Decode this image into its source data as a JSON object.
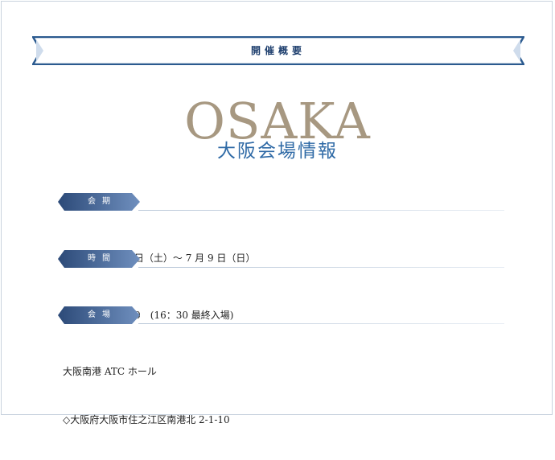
{
  "banner": {
    "title": "開催概要"
  },
  "hero": {
    "city": "OSAKA",
    "subtitle": "大阪会場情報"
  },
  "sections": [
    {
      "label": "会期",
      "lines": [
        "2017 年 7 月 8 日（土）～ 7 月 9 日（日）"
      ]
    },
    {
      "label": "時間",
      "lines": [
        "10：00 - 17：00　(16：30 最終入場)"
      ]
    },
    {
      "label": "会場",
      "lines": [
        "大阪南港 ATC ホール",
        "◇大阪府大阪市住之江区南港北 2-1-10"
      ]
    }
  ],
  "colors": {
    "navy": "#1e3f6e",
    "banner_stroke": "#2b5a8f",
    "banner_fill": "#ffffff",
    "gold": "#a79881",
    "blue": "#2f6aa6",
    "tag_dark": "#2c4a78",
    "tag_light": "#6f8fbe"
  }
}
